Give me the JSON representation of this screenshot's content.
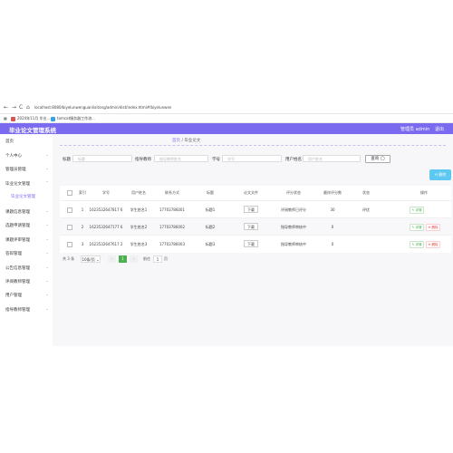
{
  "browser": {
    "nav": [
      "←",
      "→",
      "C",
      "⌂"
    ],
    "url": "localhost:8080/biyelunwenguanlixitong/admin/dist/index.html#/biyelunwen",
    "bookmarks": [
      "2024年11月 毕业...",
      "tomcat服务器工作流..."
    ]
  },
  "header": {
    "title": "毕业论文管理系统",
    "user": "管理员 admin",
    "logout": "退出"
  },
  "sidebar": {
    "items": [
      {
        "label": "首页",
        "arrow": ""
      },
      {
        "label": "个人中心",
        "arrow": "⌄"
      },
      {
        "label": "管理员管理",
        "arrow": "⌄"
      },
      {
        "label": "毕业论文管理",
        "arrow": "⌃"
      },
      {
        "label": "毕业论文管理",
        "arrow": ""
      },
      {
        "label": "课题信息管理",
        "arrow": "⌄"
      },
      {
        "label": "选题申请管理",
        "arrow": "⌄"
      },
      {
        "label": "课题评审管理",
        "arrow": "⌄"
      },
      {
        "label": "答辩管理",
        "arrow": "⌄"
      },
      {
        "label": "公告信息管理",
        "arrow": "⌄"
      },
      {
        "label": "评阅教师管理",
        "arrow": "⌄"
      },
      {
        "label": "用户管理",
        "arrow": "⌄"
      },
      {
        "label": "指导教师管理",
        "arrow": "⌄"
      }
    ]
  },
  "breadcrumb": {
    "home": "首页",
    "sep": "/",
    "current": "毕业论文"
  },
  "filters": [
    {
      "label": "标题",
      "placeholder": "标题"
    },
    {
      "label": "指导教师",
      "placeholder": "指导教师姓名"
    },
    {
      "label": "学号",
      "placeholder": "学号"
    },
    {
      "label": "用户姓名",
      "placeholder": "用户姓名"
    }
  ],
  "search_label": "查询 ◯",
  "delete_label": "⊖ 删除",
  "table": {
    "columns": [
      "索引",
      "学号",
      "用户姓名",
      "联系方式",
      "标题",
      "论文文件",
      "评分状态",
      "最终评分数",
      "状态",
      "操作"
    ],
    "rows": [
      {
        "index": "1",
        "sid": "1623532647817 6",
        "name": "学生姓名1",
        "phone": "17703786001",
        "title": "标题1",
        "file": "下载",
        "status": "评阅教师已评分",
        "score": "30",
        "state": "评优",
        "edit": "✎ 详情",
        "del": "⊖ 删除"
      },
      {
        "index": "2",
        "sid": "1623532647177 6",
        "name": "学生姓名2",
        "phone": "17703786002",
        "title": "标题2",
        "file": "下载",
        "status": "指导教师审核中",
        "score": "0",
        "state": "",
        "edit": "✎ 详情",
        "del": "⊖ 删除"
      },
      {
        "index": "3",
        "sid": "1623532647617 2",
        "name": "学生姓名3",
        "phone": "17703786003",
        "title": "标题3",
        "file": "下载",
        "status": "指导教师审核中",
        "score": "0",
        "state": "",
        "edit": "✎ 详情",
        "del": "⊖ 删除"
      }
    ]
  },
  "pager": {
    "total": "共 3 条",
    "size": "10条/页 ⌄",
    "prev": "‹",
    "page": "1",
    "next": "›",
    "goto": "前往",
    "goto_val": "1",
    "page_unit": "页"
  },
  "colors": {
    "accent": "#7a6af0",
    "delete_btn": "#5dc8f2"
  }
}
